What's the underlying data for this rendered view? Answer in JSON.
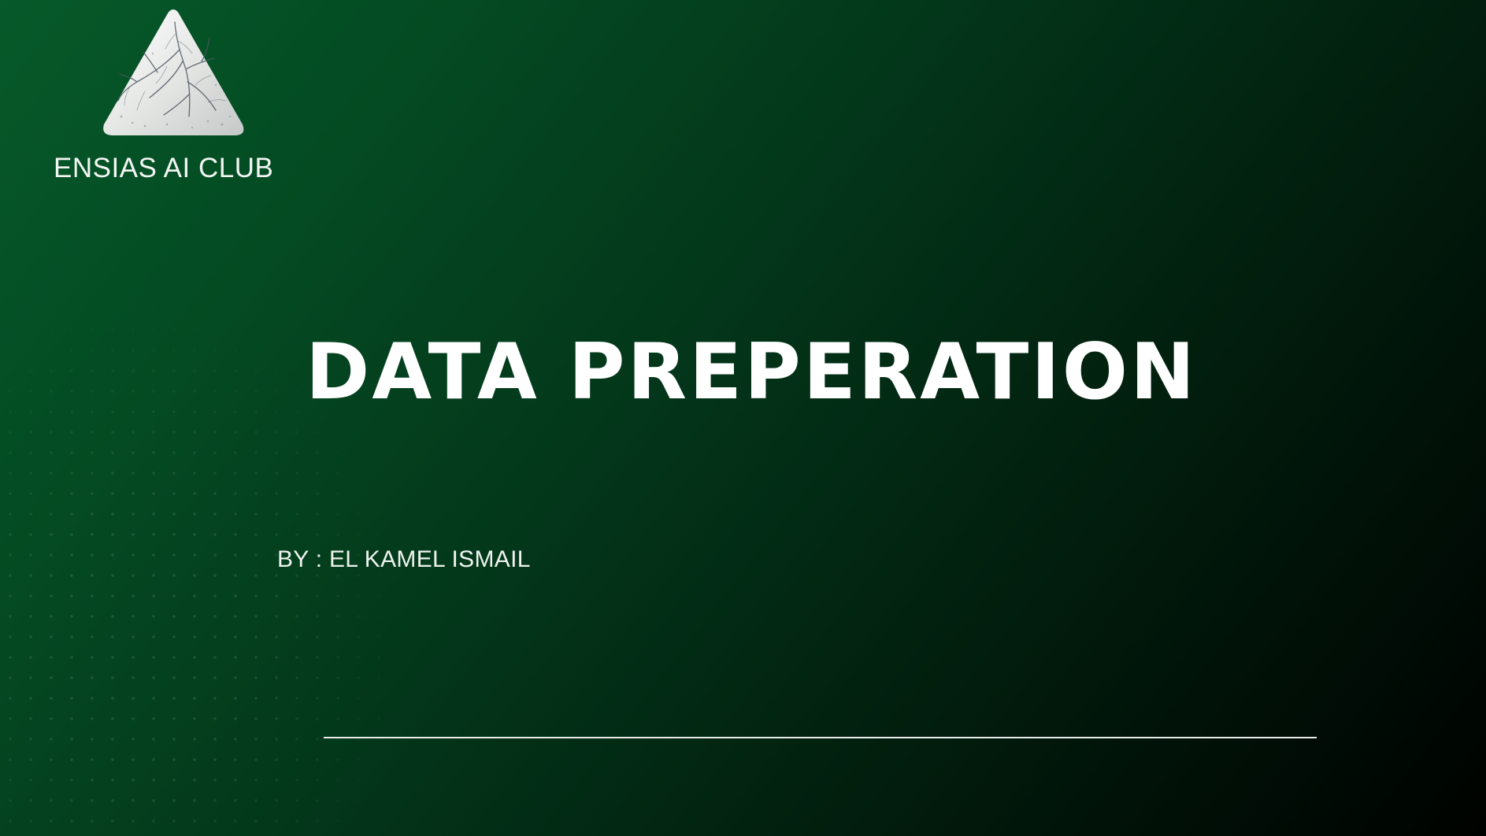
{
  "slide": {
    "club_name": "ENSIAS AI CLUB",
    "title": "DATA PREPERATION",
    "author": "BY : EL KAMEL ISMAIL"
  },
  "logo": {
    "icon": "triangle-neural-tree-logo"
  },
  "colors": {
    "background_start": "#06592a",
    "background_end": "#000200",
    "text": "#ffffff",
    "divider": "#e9ede9"
  }
}
